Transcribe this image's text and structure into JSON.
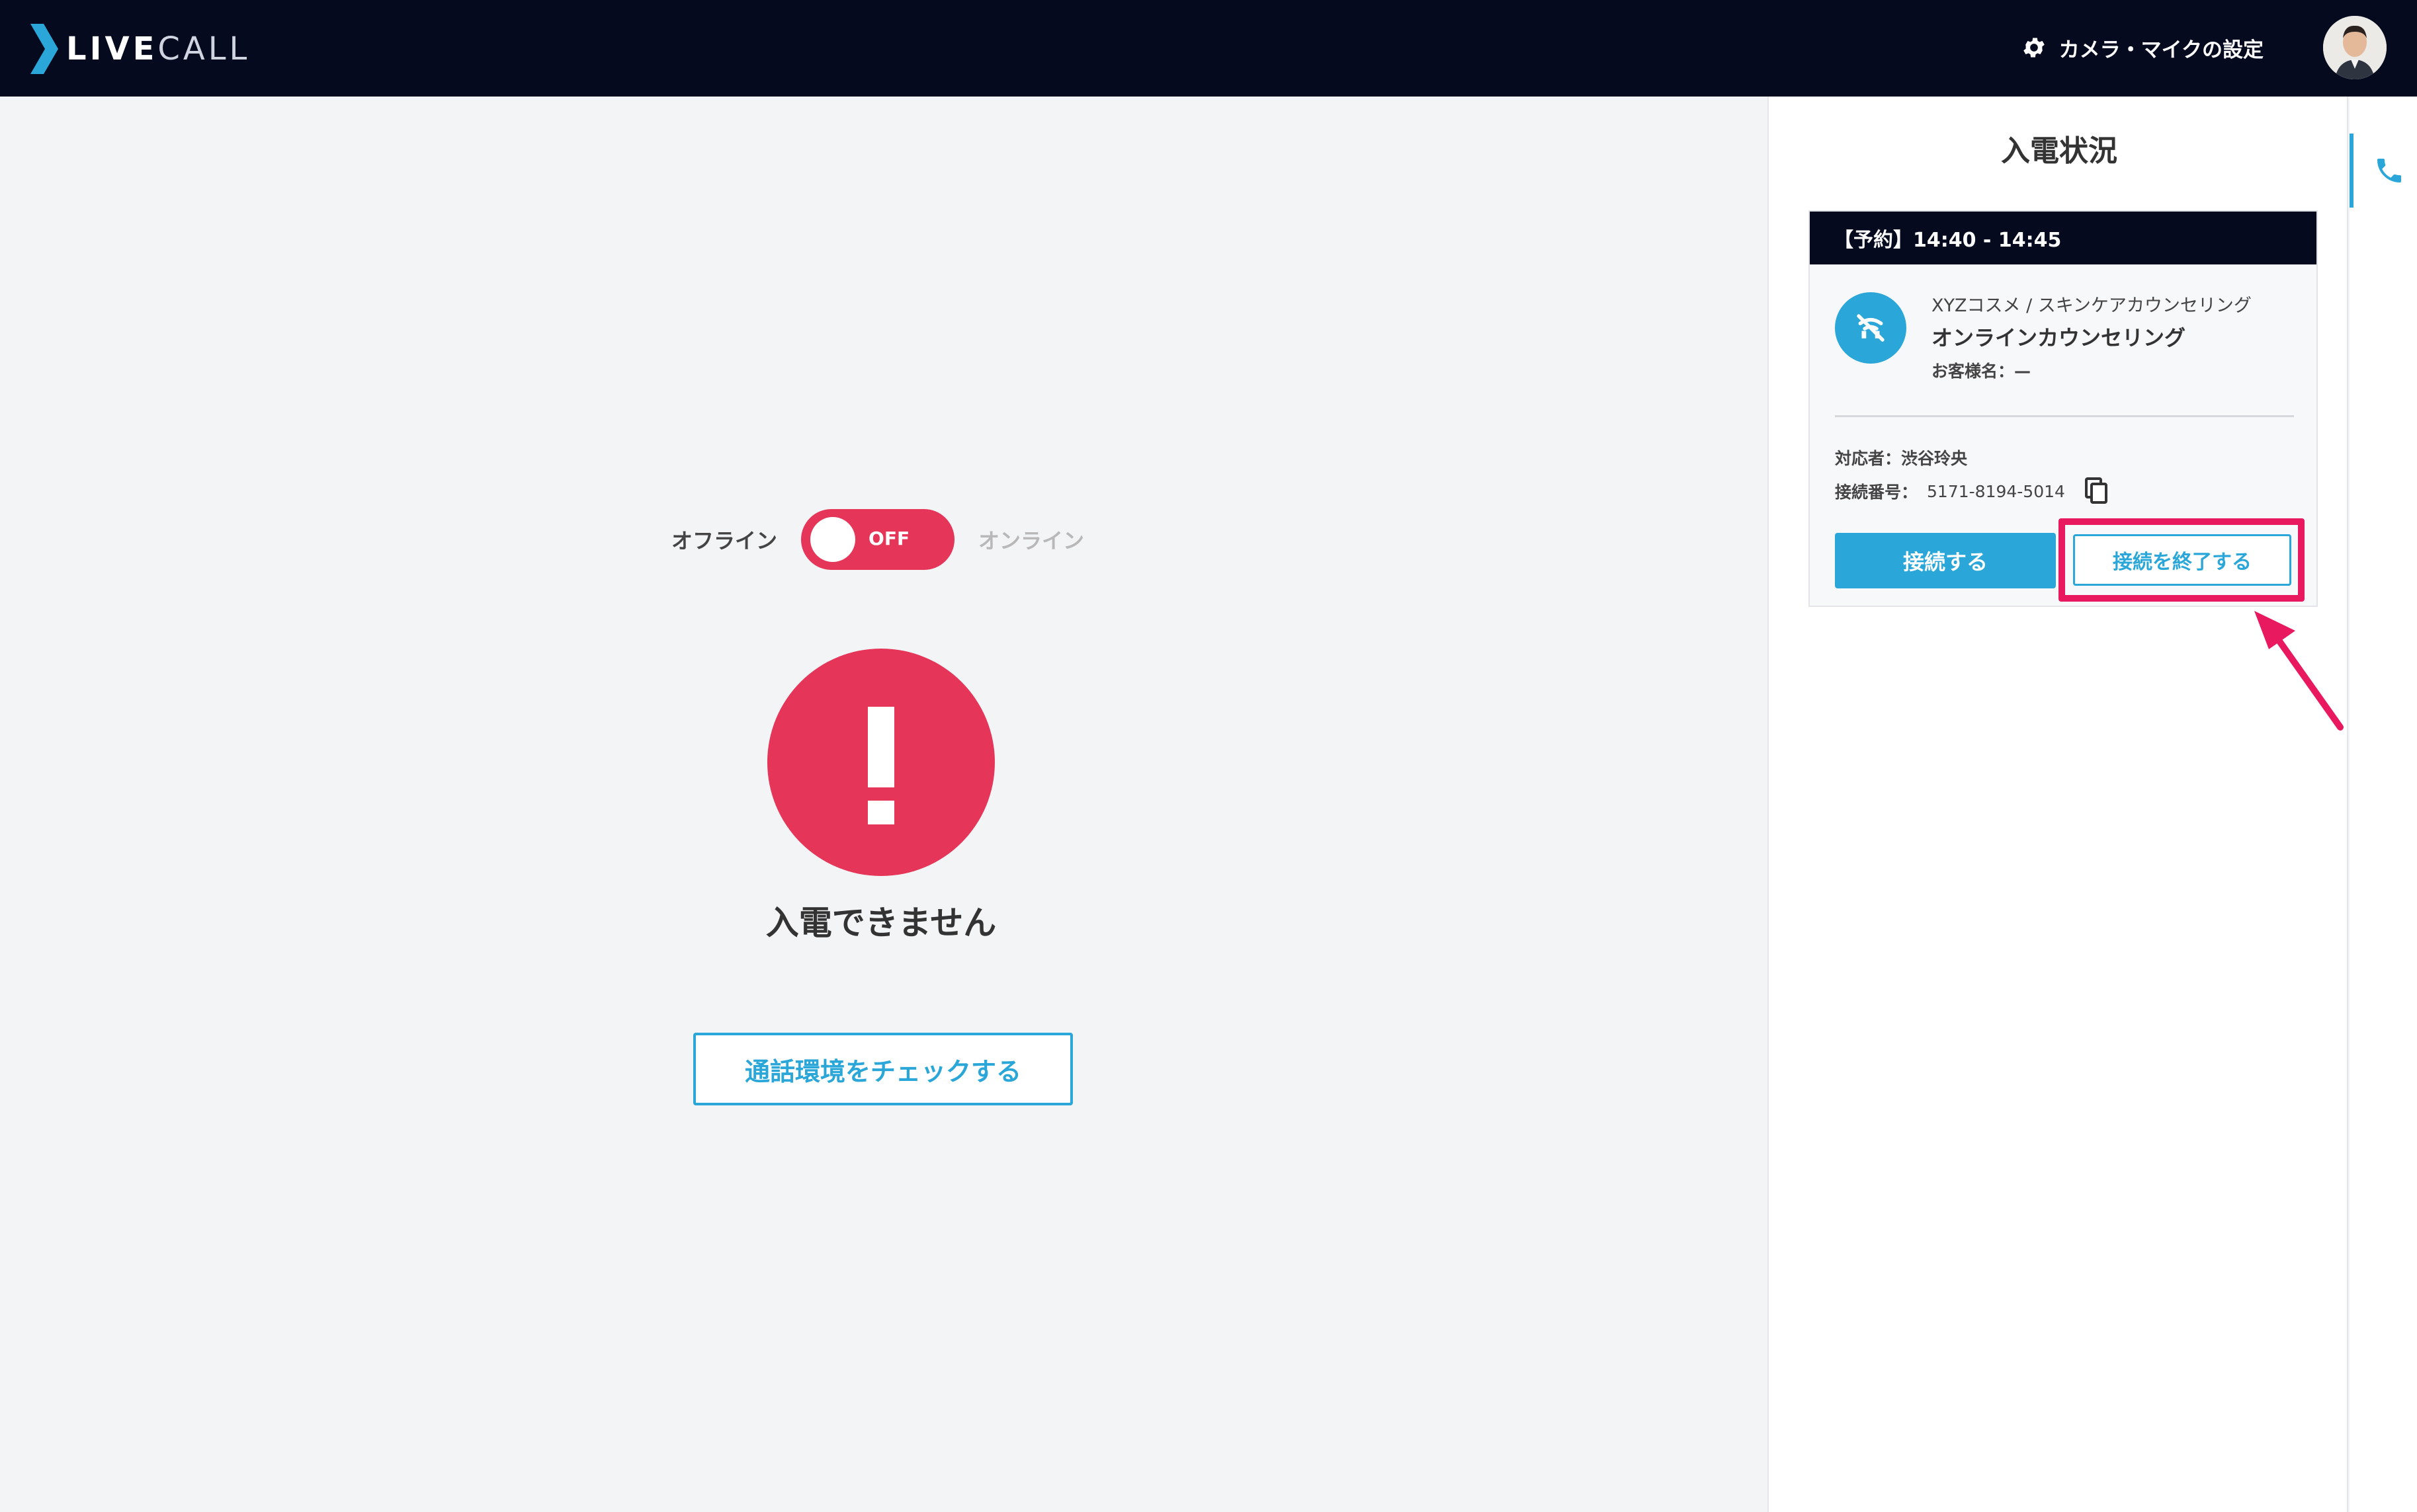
{
  "header": {
    "logo_text_bold": "LIVE",
    "logo_text_light": "CALL",
    "settings_label": "カメラ・マイクの設定",
    "settings_icon": "gear-icon",
    "avatar_icon": "user-avatar"
  },
  "main": {
    "toggle": {
      "label_offline": "オフライン",
      "state_text": "OFF",
      "label_online": "オンライン",
      "is_on": false
    },
    "status_icon": "exclamation-icon",
    "status_message": "入電できません",
    "check_button_label": "通話環境をチェックする"
  },
  "panel": {
    "title": "入電状況",
    "card": {
      "header_label": "【予約】14:40 - 14:45",
      "service_path": "XYZコスメ / スキンケアカウンセリング",
      "service_title": "オンラインカウンセリング",
      "customer_label": "お客様名：",
      "customer_value": "—",
      "staff_label": "対応者：",
      "staff_value": "渋谷玲央",
      "number_label": "接続番号：",
      "number_value": "5171-8194-5014",
      "connect_button_label": "接続する",
      "end_button_label": "接続を終了する"
    }
  },
  "right_tab": {
    "icon": "phone-icon"
  },
  "colors": {
    "header_bg": "#050a1e",
    "accent_blue": "#2aa7d8",
    "alert_red": "#e53558",
    "highlight_pink": "#e8195f"
  }
}
